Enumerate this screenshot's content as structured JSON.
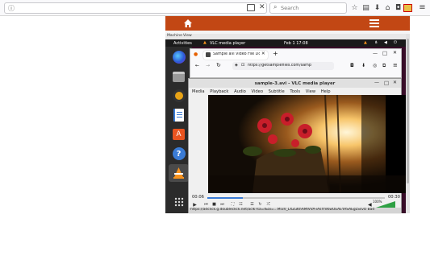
{
  "outer_browser": {
    "url_icon": "info-icon",
    "search_placeholder": "Search"
  },
  "site": {
    "home_icon": "home-icon",
    "menu_icon": "hamburger-icon"
  },
  "vm_menu": {
    "items": [
      "Machine",
      "View"
    ]
  },
  "gnome": {
    "activities": "Activities",
    "app_name": "VLC media player",
    "clock": "Feb 1  17:08"
  },
  "dock": {
    "apps": [
      "firefox-icon",
      "files-icon",
      "rhythmbox-icon",
      "libreoffice-writer-icon",
      "software-icon",
      "help-icon",
      "vlc-icon",
      "show-apps-icon"
    ]
  },
  "inner_browser": {
    "tab_title": "Sample avi Video File Do",
    "url": "https://getsamplefiles.com/samp"
  },
  "vlc": {
    "title": "sample-3.avi - VLC media player",
    "menu": [
      "Media",
      "Playback",
      "Audio",
      "Video",
      "Subtitle",
      "Tools",
      "View",
      "Help"
    ],
    "elapsed": "00:06",
    "total": "00:30",
    "volume_label": "100%",
    "progress_fraction": 0.2,
    "volume_fraction": 1.0,
    "status_url": "https://adclick.g.doubleclick.net/aclk?sa=l&ai=...MI3V_LXZuKhAMlVVA-iAsYmKwOEAEYASAEgLSsvO  Bad"
  },
  "colors": {
    "site_header": "#c24714",
    "gnome_bg": "#380d28",
    "vlc_orange": "#f7931e",
    "seek_blue": "#3a7bd5"
  }
}
